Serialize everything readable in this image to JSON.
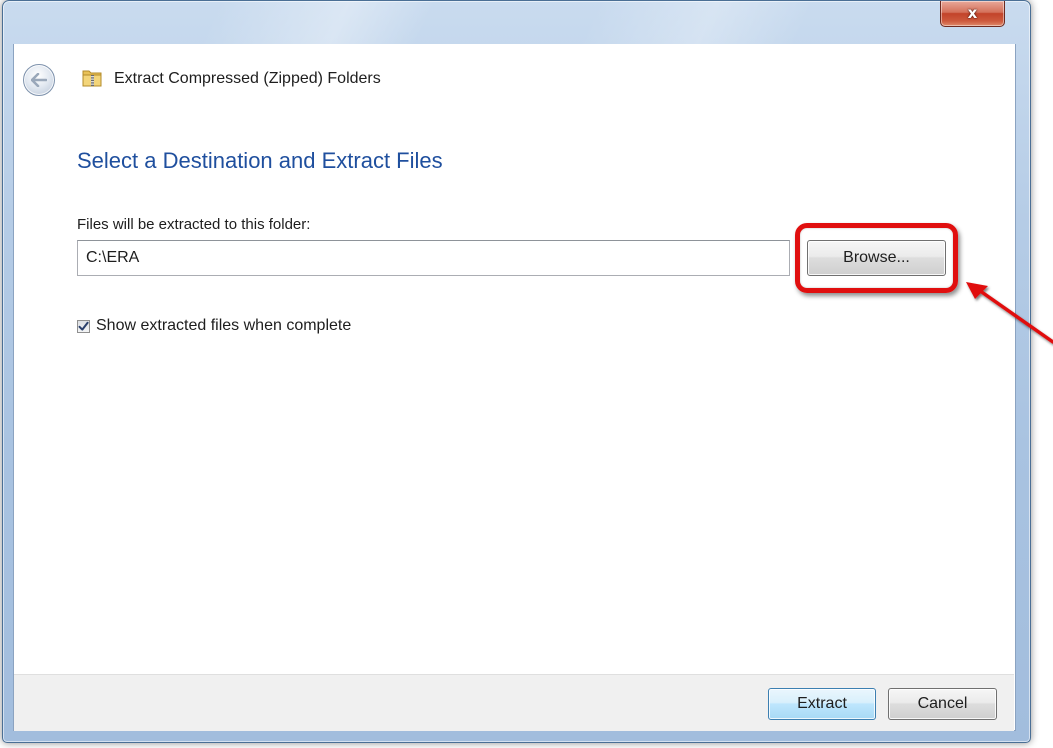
{
  "window": {
    "title": "Extract Compressed (Zipped) Folders",
    "close_glyph": "x"
  },
  "content": {
    "heading": "Select a Destination and Extract Files",
    "field_label": "Files will be extracted to this folder:",
    "path_value": "C:\\ERA",
    "browse_label": "Browse...",
    "checkbox_label": "Show extracted files when complete",
    "checkbox_checked": true
  },
  "footer": {
    "extract_label": "Extract",
    "cancel_label": "Cancel"
  },
  "icons": {
    "back": "back-arrow-icon",
    "folder": "zip-folder-icon",
    "close": "close-icon",
    "checkmark": "checkmark-icon"
  },
  "annotation": {
    "highlight_color": "#e00f0f",
    "highlighted_element": "browse-button"
  },
  "colors": {
    "heading": "#1f4f9e",
    "frame": "#a9c3e1",
    "footer": "#f0f0f0",
    "close_button": "#c2432a"
  }
}
